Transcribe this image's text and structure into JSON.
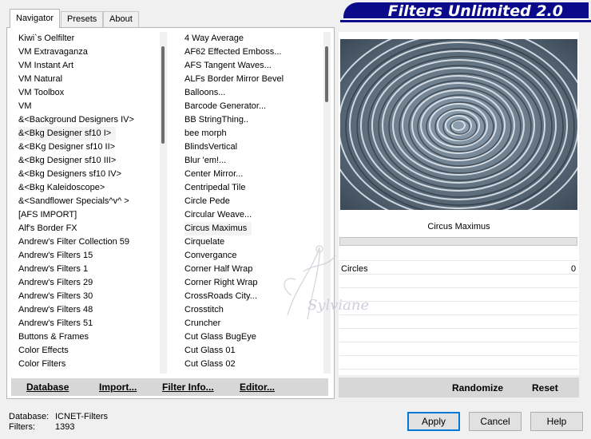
{
  "tabs": [
    {
      "label": "Navigator"
    },
    {
      "label": "Presets"
    },
    {
      "label": "About"
    }
  ],
  "banner": {
    "title": "Filters Unlimited 2.0"
  },
  "categories": [
    "Kiwi`s Oelfilter",
    "VM Extravaganza",
    "VM Instant Art",
    "VM Natural",
    "VM Toolbox",
    "VM",
    "&<Background Designers IV>",
    "&<Bkg Designer sf10 I>",
    "&<BKg Designer sf10 II>",
    "&<Bkg Designer sf10 III>",
    "&<Bkg Designers sf10 IV>",
    "&<Bkg Kaleidoscope>",
    "&<Sandflower Specials^v^ >",
    "[AFS IMPORT]",
    "Alf's Border FX",
    "Andrew's Filter Collection 59",
    "Andrew's Filters 15",
    "Andrew's Filters 1",
    "Andrew's Filters 29",
    "Andrew's Filters 30",
    "Andrew's Filters 48",
    "Andrew's Filters 51",
    "Buttons & Frames",
    "Color Effects",
    "Color Filters"
  ],
  "filters": [
    "4 Way Average",
    "AF62 Effected Emboss...",
    "AFS Tangent Waves...",
    "ALFs Border Mirror Bevel",
    "Balloons...",
    "Barcode Generator...",
    "BB StringThing..",
    "bee morph",
    "BlindsVertical",
    "Blur 'em!...",
    "Center Mirror...",
    "Centripedal Tile",
    "Circle Pede",
    "Circular Weave...",
    "Circus Maximus",
    "Cirquelate",
    "Convergance",
    "Corner Half Wrap",
    "Corner Right Wrap",
    "CrossRoads City...",
    "Crosstitch",
    "Cruncher",
    "Cut Glass  BugEye",
    "Cut Glass 01",
    "Cut Glass 02"
  ],
  "bottom_buttons": {
    "database": "Database",
    "import": "Import...",
    "filter_info": "Filter Info...",
    "editor": "Editor..."
  },
  "selected_filter": "Circus Maximus",
  "parameter": {
    "name": "Circles",
    "value": "0"
  },
  "right_buttons": {
    "randomize": "Randomize",
    "reset": "Reset"
  },
  "status": {
    "database_label": "Database:",
    "database_value": "ICNET-Filters",
    "filters_label": "Filters:",
    "filters_value": "1393"
  },
  "dialog_buttons": {
    "apply": "Apply",
    "cancel": "Cancel",
    "help": "Help"
  },
  "watermark": "Sylviane",
  "colors": {
    "banner": "#0a0a8a",
    "accent": "#0078d7"
  }
}
